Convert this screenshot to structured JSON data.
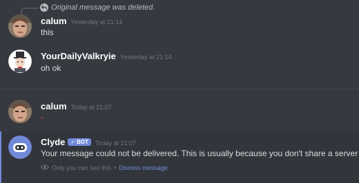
{
  "reply": {
    "text": "Original message was deleted."
  },
  "messages": [
    {
      "username": "calum",
      "timestamp": "Yesterday at 21:14",
      "content": "this",
      "avatar_icon": "user-avatar-calum"
    },
    {
      "username": "YourDailyValkryie",
      "timestamp": "Yesterday at 21:14",
      "content": "oh ok",
      "avatar_icon": "user-avatar-valkyrie"
    },
    {
      "username": "calum",
      "timestamp": "Today at 21:07",
      "content": "-",
      "avatar_icon": "user-avatar-calum"
    },
    {
      "username": "Clyde",
      "badge": "BOT",
      "timestamp": "Today at 21:07",
      "content": "Your message could not be delivered. This is usually because you don't share a server w",
      "avatar_icon": "clyde-bot-avatar"
    }
  ],
  "clyde_meta": {
    "visibility": "Only you can see this",
    "separator": "•",
    "dismiss": "Dismiss message"
  },
  "colors": {
    "background": "#36393f",
    "username": "#ffffff",
    "text": "#dcddde",
    "timestamp": "#72767d",
    "accent": "#7289da"
  }
}
